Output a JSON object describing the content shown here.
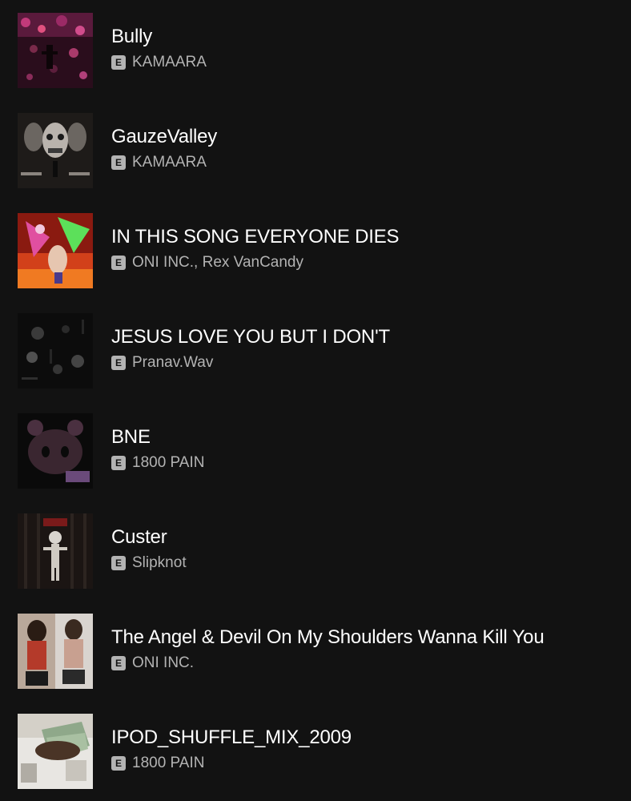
{
  "tracks": [
    {
      "title": "Bully",
      "explicit": "E",
      "artist": "KAMAARA",
      "cover_icon": "album-cover-bully"
    },
    {
      "title": "GauzeValley",
      "explicit": "E",
      "artist": "KAMAARA",
      "cover_icon": "album-cover-gauzevalley"
    },
    {
      "title": "IN THIS SONG EVERYONE DIES",
      "explicit": "E",
      "artist": "ONI INC., Rex VanCandy",
      "cover_icon": "album-cover-in-this-song"
    },
    {
      "title": "JESUS LOVE YOU BUT I DON'T",
      "explicit": "E",
      "artist": "Pranav.Wav",
      "cover_icon": "album-cover-jesus-love-you"
    },
    {
      "title": "BNE",
      "explicit": "E",
      "artist": "1800 PAIN",
      "cover_icon": "album-cover-bne"
    },
    {
      "title": "Custer",
      "explicit": "E",
      "artist": "Slipknot",
      "cover_icon": "album-cover-custer"
    },
    {
      "title": "The Angel & Devil On My Shoulders Wanna Kill You",
      "explicit": "E",
      "artist": "ONI INC.",
      "cover_icon": "album-cover-angel-devil"
    },
    {
      "title": "IPOD_SHUFFLE_MIX_2009",
      "explicit": "E",
      "artist": "1800 PAIN",
      "cover_icon": "album-cover-ipod-shuffle"
    }
  ],
  "colors": {
    "background": "#121212",
    "title_text": "#ffffff",
    "secondary_text": "#b3b3b3",
    "explicit_badge": "#b3b3b3"
  }
}
